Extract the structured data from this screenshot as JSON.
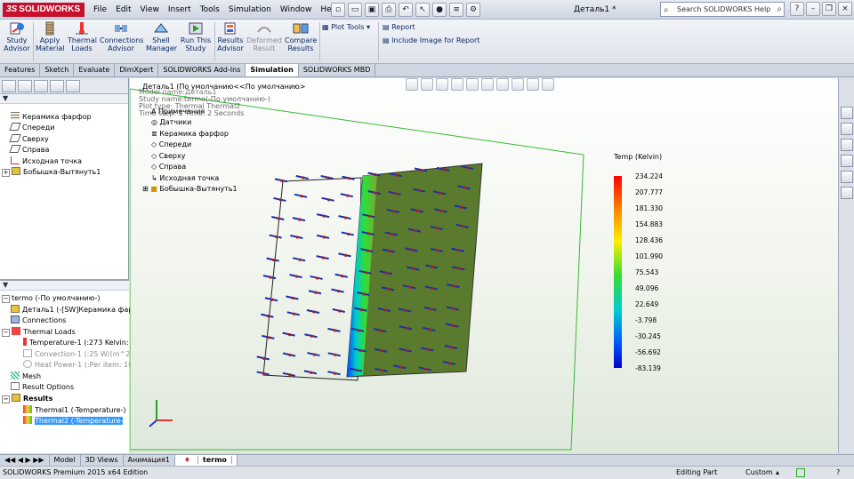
{
  "app": {
    "brand": "SOLIDWORKS",
    "document_title": "Деталь1 *",
    "search_placeholder": "Search SOLIDWORKS Help"
  },
  "menu": [
    "File",
    "Edit",
    "View",
    "Insert",
    "Tools",
    "Simulation",
    "Window",
    "Help"
  ],
  "ribbon": {
    "study_advisor": "Study Advisor",
    "apply_material": "Apply Material",
    "thermal_loads": "Thermal Loads",
    "connections_advisor": "Connections Advisor",
    "shell_manager": "Shell Manager",
    "run_this_study": "Run This Study",
    "results_advisor": "Results Advisor",
    "deformed_result": "Deformed Result",
    "compare_results": "Compare Results",
    "plot_tools": "Plot Tools",
    "report": "Report",
    "include_image": "Include Image for Report"
  },
  "tabs": [
    "Features",
    "Sketch",
    "Evaluate",
    "DimXpert",
    "SOLIDWORKS Add-Ins",
    "Simulation",
    "SOLIDWORKS MBD"
  ],
  "active_tab": "Simulation",
  "feature_tree": {
    "items": [
      "Керамика фарфор",
      "Спереди",
      "Сверху",
      "Справа",
      "Исходная точка",
      "Бобышка-Вытянуть1"
    ]
  },
  "sim_tree": {
    "root": "termo (-По умолчанию-)",
    "part": "Деталь1 (-[SW]Керамика фарф",
    "connections": "Connections",
    "thermal_loads": "Thermal Loads",
    "temperature": "Temperature-1 (:273 Kelvin:",
    "convection": "Convection-1 (:25 W/(m^2.",
    "heat_power": "Heat Power-1 (:Per item: 10",
    "mesh": "Mesh",
    "result_options": "Result Options",
    "results": "Results",
    "thermal1": "Thermal1 (-Temperature-)",
    "thermal2": "Thermal2 (-Temperature-"
  },
  "viewport": {
    "header_lines": [
      "Model name:Деталь1",
      "Study name:termo(-По умолчанию-)",
      "Plot type: Thermal Thermal2",
      "Time step: 1   Time: 2 Seconds"
    ],
    "tree": {
      "part": "Деталь1 (По умолчанию<<По умолчанию>",
      "items": [
        "Примечания",
        "Датчики",
        "Керамика фарфор",
        "Спереди",
        "Сверху",
        "Справа",
        "Исходная точка",
        "Бобышка-Вытянуть1"
      ]
    }
  },
  "legend": {
    "title": "Temp (Kelvin)",
    "values": [
      "234.224",
      "207.777",
      "181.330",
      "154.883",
      "128.436",
      "101.990",
      "75.543",
      "49.096",
      "22.649",
      "-3.798",
      "-30.245",
      "-56.692",
      "-83.139"
    ]
  },
  "bottom_tabs": [
    "Model",
    "3D Views",
    "Анимация1",
    "termo"
  ],
  "active_bottom_tab": "termo",
  "status": {
    "edition": "SOLIDWORKS Premium 2015 x64 Edition",
    "mode": "Editing Part",
    "units": "Custom"
  }
}
